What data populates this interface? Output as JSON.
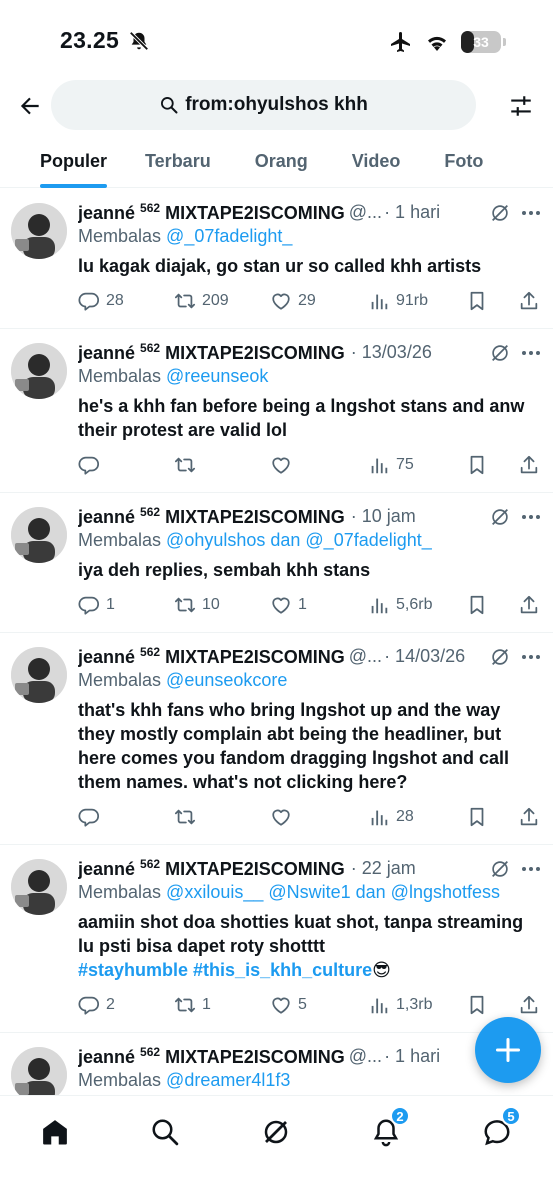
{
  "status_bar": {
    "time": "23.25",
    "battery": "33",
    "battery_level": 0.33
  },
  "search": {
    "query": "from:ohyulshos khh"
  },
  "tabs": [
    {
      "label": "Populer",
      "active": true
    },
    {
      "label": "Terbaru",
      "active": false
    },
    {
      "label": "Orang",
      "active": false
    },
    {
      "label": "Video",
      "active": false
    },
    {
      "label": "Foto",
      "active": false
    }
  ],
  "tweets": [
    {
      "name": "jeanné",
      "name_sup": "562",
      "name_tail": "MIXTAPE2ISCOMING",
      "handle": "@...",
      "time": "· 1 hari",
      "reply_prefix": "Membalas",
      "reply_to": "@_07fadelight_",
      "text": "lu kagak diajak, go stan ur so called khh artists",
      "replies": "28",
      "retweets": "209",
      "likes": "29",
      "views": "91rb"
    },
    {
      "name": "jeanné",
      "name_sup": "562",
      "name_tail": "MIXTAPE2ISCOMING",
      "handle": "",
      "time": "· 13/03/26",
      "reply_prefix": "Membalas",
      "reply_to": "@reeunseok",
      "text": "he's a khh fan before being a lngshot stans and anw their protest are valid lol",
      "replies": "",
      "retweets": "",
      "likes": "",
      "views": "75"
    },
    {
      "name": "jeanné",
      "name_sup": "562",
      "name_tail": "MIXTAPE2ISCOMING",
      "handle": "",
      "time": "· 10 jam",
      "reply_prefix": "Membalas",
      "reply_to": "@ohyulshos dan @_07fadelight_",
      "text": "iya deh replies, sembah khh stans",
      "replies": "1",
      "retweets": "10",
      "likes": "1",
      "views": "5,6rb"
    },
    {
      "name": "jeanné",
      "name_sup": "562",
      "name_tail": "MIXTAPE2ISCOMING",
      "handle": "@...",
      "time": "· 14/03/26",
      "reply_prefix": "Membalas",
      "reply_to": "@eunseokcore",
      "text": "that's khh fans who bring lngshot up and the way they mostly complain abt being the headliner, but here comes you fandom dragging lngshot and call them names. what's not clicking here?",
      "replies": "",
      "retweets": "",
      "likes": "",
      "views": "28"
    },
    {
      "name": "jeanné",
      "name_sup": "562",
      "name_tail": "MIXTAPE2ISCOMING",
      "handle": "",
      "time": "· 22 jam",
      "reply_prefix": "Membalas",
      "reply_to": "@xxilouis__ @Nswite1 dan @lngshotfess",
      "text": "aamiin shot doa shotties kuat shot, tanpa streaming lu psti bisa dapet roty shotttt",
      "hashtags": "#stayhumble #this_is_khh_culture",
      "emoji": "😎",
      "replies": "2",
      "retweets": "1",
      "likes": "5",
      "views": "1,3rb"
    },
    {
      "name": "jeanné",
      "name_sup": "562",
      "name_tail": "MIXTAPE2ISCOMING",
      "handle": "@...",
      "time": "· 1 hari",
      "reply_prefix": "Membalas",
      "reply_to": "@dreamer4l1f3",
      "text": "",
      "replies": "",
      "retweets": "",
      "likes": "",
      "views": ""
    }
  ],
  "bottom_nav": {
    "notifications_badge": "2",
    "messages_badge": "5"
  },
  "colors": {
    "accent": "#1d9bf0",
    "text": "#0f1419",
    "muted": "#536471"
  }
}
